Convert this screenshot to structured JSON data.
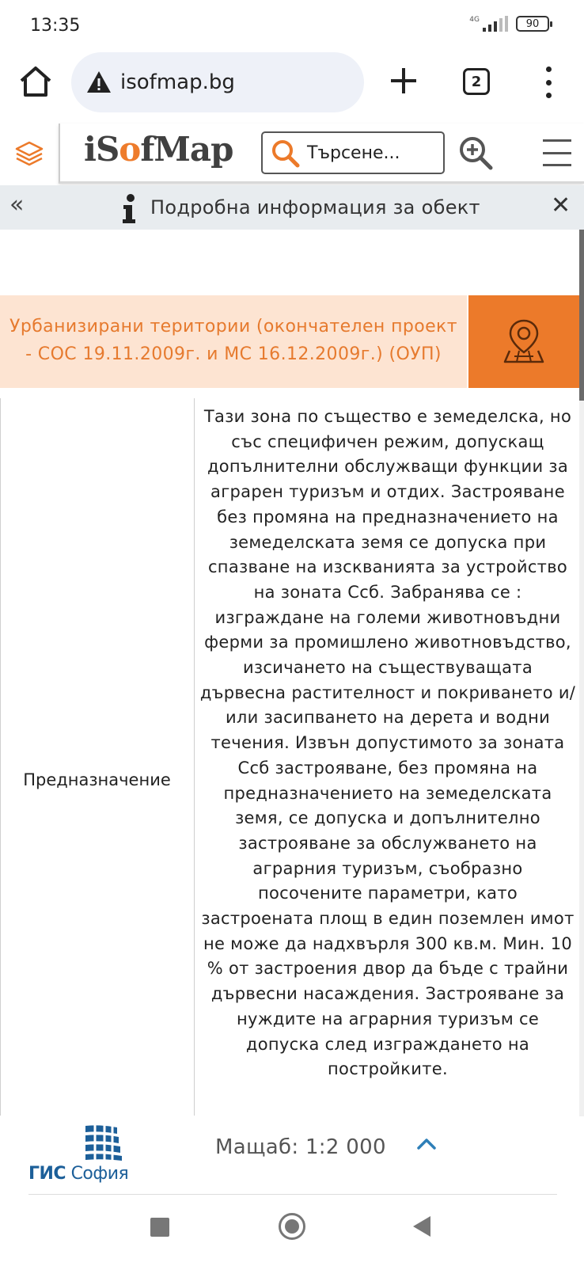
{
  "status_bar": {
    "time": "13:35",
    "network": "4G",
    "battery": "90"
  },
  "browser": {
    "url": "isofmap.bg",
    "tab_count": "2"
  },
  "app": {
    "logo_prefix": "iS",
    "logo_accent": "o",
    "logo_suffix": "fMap",
    "search_placeholder": "Търсене...",
    "accent_color": "#ec7a2a"
  },
  "info_panel": {
    "collapse_label": "«",
    "title": "Подробна информация за обект",
    "close_label": "✕"
  },
  "layer": {
    "title": "Урбанизирани територии (окончателен проект - СОС 19.11.2009г. и МС 16.12.2009г.) (ОУП)"
  },
  "attributes": [
    {
      "key": "Предназначение",
      "value": "Тази зона по същество е земеделска, но със специфичен режим, допускащ допълнителни обслужващи функции за аграрен туризъм и отдих. Застрояване без промяна на предназначението на земеделската земя се допуска при спазване на изскванията за устройство на зоната Ссб. Забранява се : изграждане на големи животновъдни ферми за промишлено животновъдство, изсичането на съществуващата дървесна растителност и покриването и/или засипването на дерета и водни течения. Извън допустимото за зоната Ссб застрояване, без промяна на предназначението на земеделската земя, се допуска и допълнително застрояване за обслужването на аграрния туризъм, съобразно посочените параметри, като застроената площ в един поземлен имот не може да надхвърля 300 кв.м. Мин. 10 % от застроения двор да бъде с трайни дървесни насаждения. Застрояване за нуждите на аграрния туризъм се допуска след изграждането на постройките."
    }
  ],
  "footer": {
    "gis_bold": "ГИС",
    "gis_light": " София",
    "scale_label": "Мащаб: 1:2 000"
  }
}
